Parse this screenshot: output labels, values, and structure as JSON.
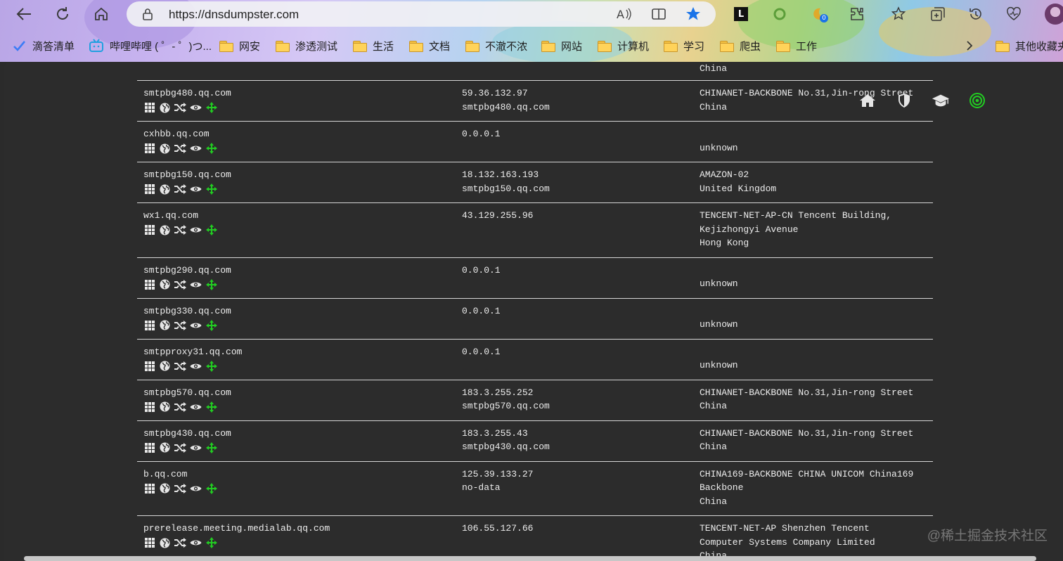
{
  "browser": {
    "url": "https://dnsdumpster.com",
    "extension_badge": "0",
    "bookmarks": [
      {
        "label": "滴答清单",
        "icon": "check-icon"
      },
      {
        "label": "哔哩哔哩 ( ゜- ゜)つ...",
        "icon": "bilibili-icon"
      },
      {
        "label": "网安",
        "icon": "folder-icon"
      },
      {
        "label": "渗透测试",
        "icon": "folder-icon"
      },
      {
        "label": "生活",
        "icon": "folder-icon"
      },
      {
        "label": "文档",
        "icon": "folder-icon"
      },
      {
        "label": "不澈不浓",
        "icon": "folder-icon"
      },
      {
        "label": "网站",
        "icon": "folder-icon"
      },
      {
        "label": "计算机",
        "icon": "folder-icon"
      },
      {
        "label": "学习",
        "icon": "folder-icon"
      },
      {
        "label": "爬虫",
        "icon": "folder-icon"
      },
      {
        "label": "工作",
        "icon": "folder-icon"
      }
    ],
    "other_bookmarks": "其他收藏夹"
  },
  "results": {
    "top_partial": "China",
    "rows": [
      {
        "host": "smtpbg480.qq.com",
        "ip": "59.36.132.97",
        "reverse": "smtpbg480.qq.com",
        "asn": [
          "CHINANET-BACKBONE No.31,Jin-rong Street",
          "China"
        ]
      },
      {
        "host": "cxhbb.qq.com",
        "ip": "0.0.0.1",
        "reverse": "",
        "asn": [
          "",
          "unknown"
        ]
      },
      {
        "host": "smtpbg150.qq.com",
        "ip": "18.132.163.193",
        "reverse": "smtpbg150.qq.com",
        "asn": [
          "AMAZON-02",
          "United Kingdom"
        ]
      },
      {
        "host": "wx1.qq.com",
        "ip": "43.129.255.96",
        "reverse": "",
        "asn": [
          "TENCENT-NET-AP-CN Tencent Building,",
          "Kejizhongyi Avenue",
          "Hong Kong"
        ]
      },
      {
        "host": "smtpbg290.qq.com",
        "ip": "0.0.0.1",
        "reverse": "",
        "asn": [
          "",
          "unknown"
        ]
      },
      {
        "host": "smtpbg330.qq.com",
        "ip": "0.0.0.1",
        "reverse": "",
        "asn": [
          "",
          "unknown"
        ]
      },
      {
        "host": "smtpproxy31.qq.com",
        "ip": "0.0.0.1",
        "reverse": "",
        "asn": [
          "",
          "unknown"
        ]
      },
      {
        "host": "smtpbg570.qq.com",
        "ip": "183.3.255.252",
        "reverse": "smtpbg570.qq.com",
        "asn": [
          "CHINANET-BACKBONE No.31,Jin-rong Street",
          "China"
        ]
      },
      {
        "host": "smtpbg430.qq.com",
        "ip": "183.3.255.43",
        "reverse": "smtpbg430.qq.com",
        "asn": [
          "CHINANET-BACKBONE No.31,Jin-rong Street",
          "China"
        ]
      },
      {
        "host": "b.qq.com",
        "ip": "125.39.133.27",
        "reverse": "no-data",
        "asn": [
          "CHINA169-BACKBONE CHINA UNICOM China169",
          "Backbone",
          "China"
        ]
      },
      {
        "host": "prerelease.meeting.medialab.qq.com",
        "ip": "106.55.127.66",
        "reverse": "",
        "asn": [
          "TENCENT-NET-AP Shenzhen Tencent",
          "Computer Systems Company Limited",
          "China"
        ]
      }
    ],
    "row_icons": [
      "grid-icon",
      "globe-icon",
      "shuffle-icon",
      "eye-icon",
      "crosshair-icon"
    ]
  },
  "nav_icons": [
    "home-icon",
    "shield-icon",
    "graduation-cap-icon",
    "target-icon"
  ],
  "watermark": "@稀土掘金技术社区",
  "colors": {
    "page_bg": "#2c2c2c",
    "text": "#ececec",
    "accent_green": "#22cc22"
  }
}
